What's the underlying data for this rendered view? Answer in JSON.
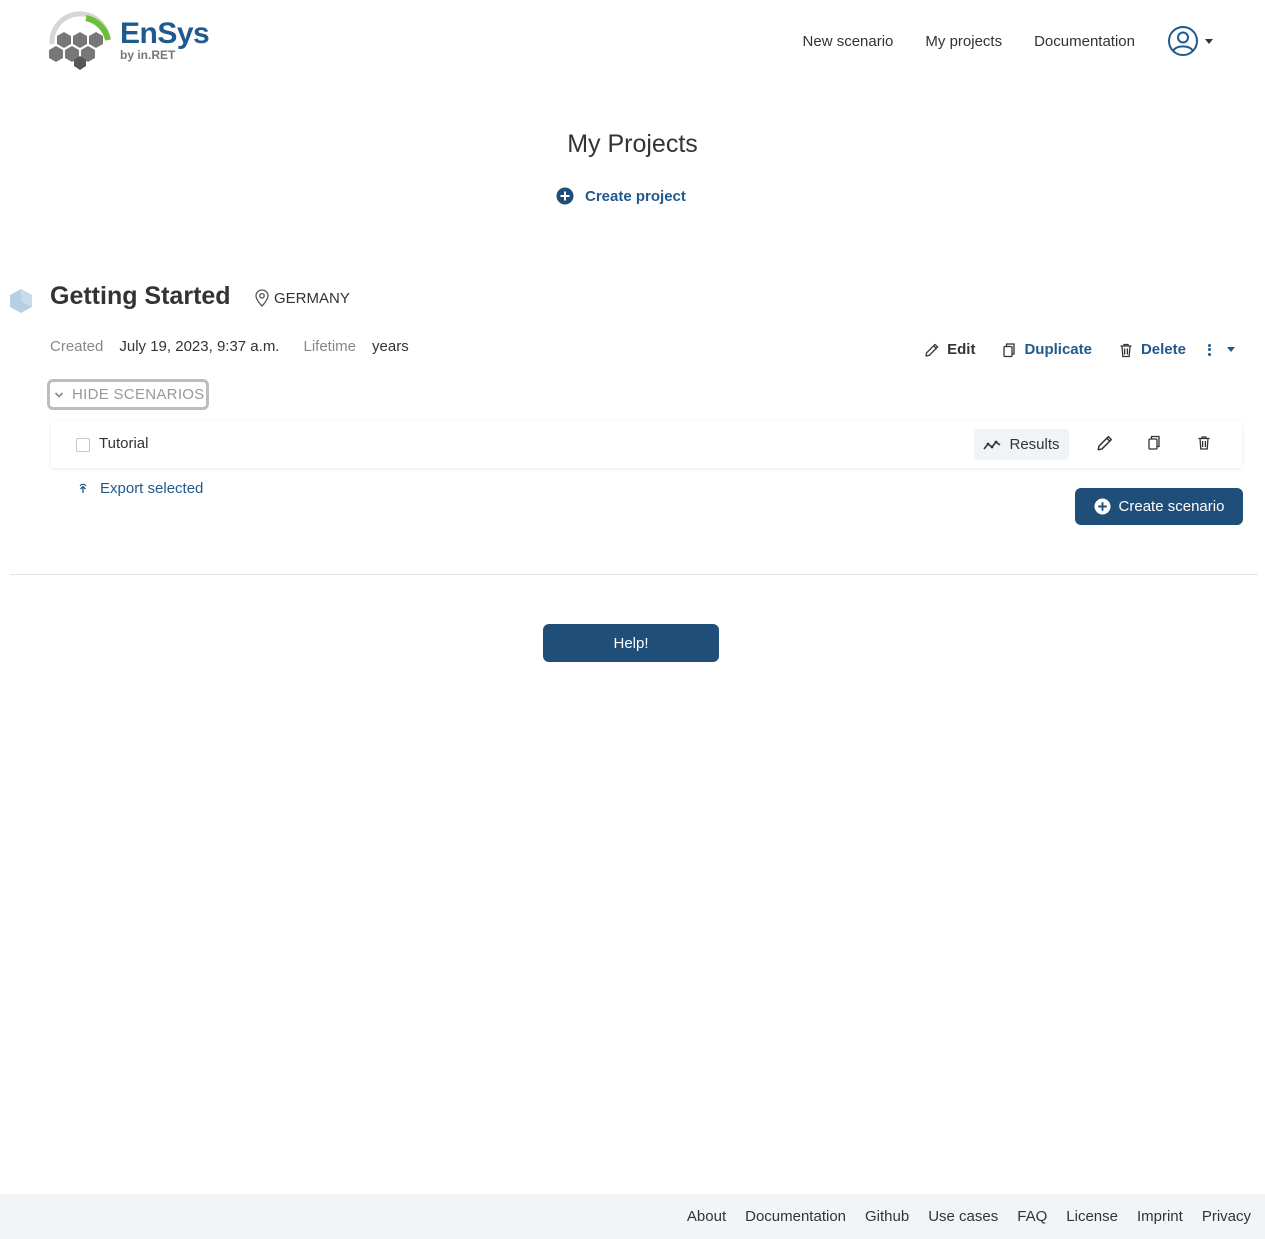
{
  "brand": {
    "name": "EnSys",
    "subtitle": "by in.RET",
    "colors": {
      "primary": "#1f5a8e",
      "button": "#1f4e79",
      "accent_green": "#6bbf3b"
    }
  },
  "nav": {
    "links": [
      "New scenario",
      "My projects",
      "Documentation"
    ],
    "user_icon": "user-circle-icon"
  },
  "page": {
    "title": "My Projects",
    "create_project_label": "Create project"
  },
  "project": {
    "name": "Getting Started",
    "location": "GERMANY",
    "created_label": "Created",
    "created_value": "July 19, 2023, 9:37 a.m.",
    "lifetime_label": "Lifetime",
    "lifetime_value": "years",
    "actions": {
      "edit": "Edit",
      "duplicate": "Duplicate",
      "delete": "Delete"
    },
    "toggle_label": "HIDE SCENARIOS",
    "scenarios": [
      {
        "name": "Tutorial",
        "results_label": "Results",
        "checked": false
      }
    ],
    "export_label": "Export selected",
    "create_scenario_label": "Create scenario"
  },
  "help_label": "Help!",
  "footer": {
    "links": [
      "About",
      "Documentation",
      "Github",
      "Use cases",
      "FAQ",
      "License",
      "Imprint",
      "Privacy"
    ]
  }
}
